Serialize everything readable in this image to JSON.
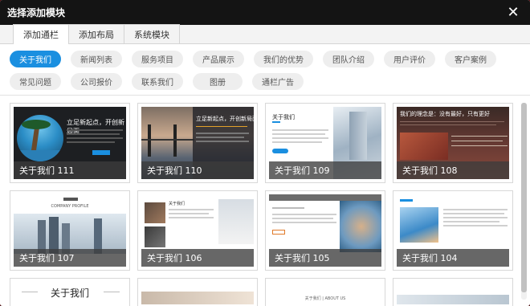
{
  "dialog": {
    "title": "选择添加模块",
    "close_glyph": "✕"
  },
  "tabs": [
    {
      "label": "添加通栏",
      "active": true
    },
    {
      "label": "添加布局",
      "active": false
    },
    {
      "label": "系统模块",
      "active": false
    }
  ],
  "categories": [
    {
      "label": "关于我们",
      "active": true
    },
    {
      "label": "新闻列表"
    },
    {
      "label": "服务项目"
    },
    {
      "label": "产品展示"
    },
    {
      "label": "我们的优势"
    },
    {
      "label": "团队介绍"
    },
    {
      "label": "用户评价"
    },
    {
      "label": "客户案例"
    },
    {
      "label": "常见问题"
    },
    {
      "label": "公司报价"
    },
    {
      "label": "联系我们"
    },
    {
      "label": "图册"
    },
    {
      "label": "通栏广告"
    }
  ],
  "templates": [
    {
      "caption": "关于我们 111",
      "style": "dark-palm",
      "headline": "立足新起点，开创新局面"
    },
    {
      "caption": "关于我们 110",
      "style": "bridge",
      "headline": "立足新起点，开创新局面"
    },
    {
      "caption": "关于我们 109",
      "style": "light-building",
      "headline": "关于我们"
    },
    {
      "caption": "关于我们 108",
      "style": "red-team",
      "headline": "我们的理念是：没有最好，只有更好"
    },
    {
      "caption": "关于我们 107",
      "style": "city",
      "headline": "COMPANY PROFILE"
    },
    {
      "caption": "关于我们 106",
      "style": "camera",
      "headline": "关于我们"
    },
    {
      "caption": "关于我们 105",
      "style": "hands",
      "headline": ""
    },
    {
      "caption": "关于我们 104",
      "style": "blue-people",
      "headline": ""
    }
  ],
  "partial_row": [
    {
      "headline": "关于我们"
    },
    {
      "headline": ""
    },
    {
      "headline": "关于我们 | ABOUT US"
    },
    {
      "headline": ""
    }
  ],
  "colors": {
    "accent": "#1a8fe0",
    "titlebar": "#141414"
  }
}
